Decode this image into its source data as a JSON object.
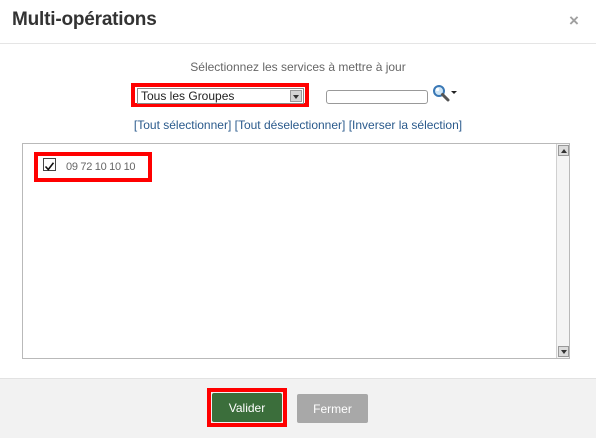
{
  "dialog": {
    "title": "Multi-opérations",
    "close_icon": "close-icon",
    "close_glyph": "×"
  },
  "selection": {
    "instruction": "Sélectionnez les services à mettre à jour",
    "group_select_value": "Tous les Groupes",
    "search_value": "",
    "search_icon": "magnifier-icon"
  },
  "links": {
    "select_all": "[Tout sélectionner]",
    "deselect_all": "[Tout déselectionner]",
    "invert": "[Inverser la sélection]"
  },
  "services": [
    {
      "label": "09 72 10 10 10",
      "checked": true
    }
  ],
  "footer": {
    "validate_label": "Valider",
    "close_label": "Fermer"
  },
  "colors": {
    "highlight": "#ff0000",
    "validate_bg": "#3b6e3b",
    "close_bg": "#a8a8a8",
    "link": "#2a5a8c"
  }
}
